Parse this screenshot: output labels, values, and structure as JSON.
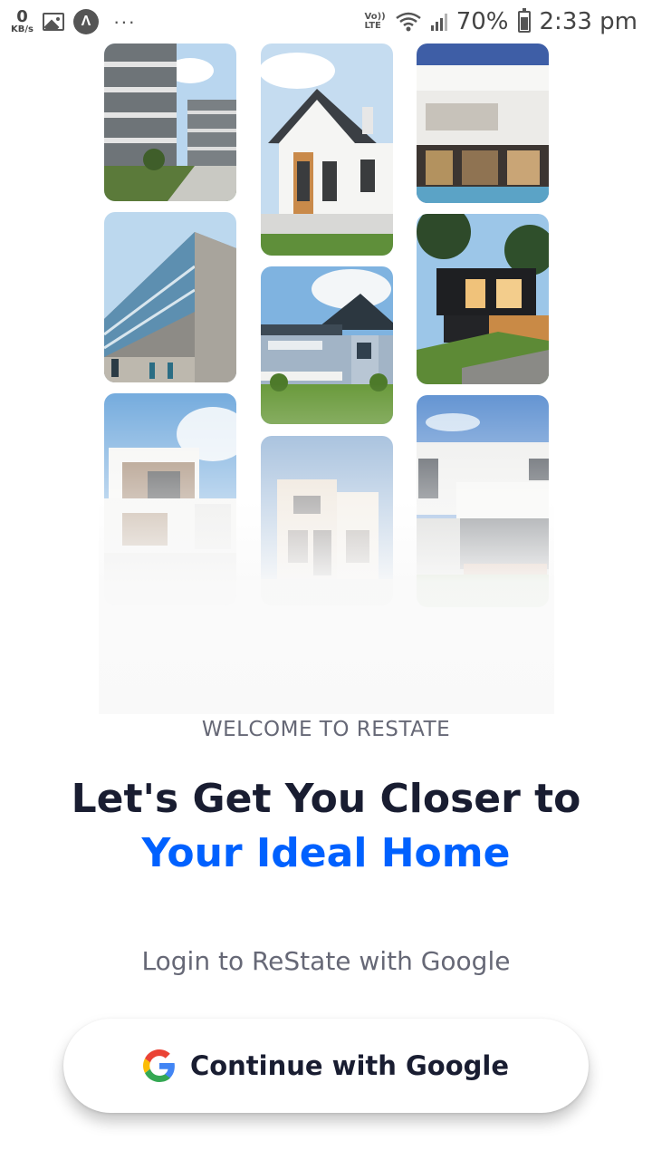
{
  "status_bar": {
    "net_speed_value": "0",
    "net_speed_unit": "KB/s",
    "more_label": "···",
    "volte_top": "Vo))",
    "volte_bottom": "LTE",
    "battery_percent": "70%",
    "battery_level": 0.7,
    "time": "2:33 pm",
    "icons": [
      "image-icon",
      "app-a-icon",
      "wifi-icon",
      "signal-icon",
      "battery-icon"
    ]
  },
  "collage": {
    "images": [
      {
        "name": "apartment-building",
        "column": 1
      },
      {
        "name": "glass-facade-building",
        "column": 1
      },
      {
        "name": "modern-white-villa",
        "column": 1
      },
      {
        "name": "gabled-house",
        "column": 2
      },
      {
        "name": "blue-siding-house",
        "column": 2
      },
      {
        "name": "beige-townhouse",
        "column": 2
      },
      {
        "name": "white-modern-pool-house",
        "column": 3
      },
      {
        "name": "black-modern-house",
        "column": 3
      },
      {
        "name": "white-cube-house",
        "column": 3
      }
    ]
  },
  "welcome": {
    "eyebrow": "WELCOME TO RESTATE",
    "headline_line1": "Let's Get You Closer to",
    "headline_line2": "Your Ideal Home",
    "subtitle": "Login to ReState with Google"
  },
  "google_button": {
    "label": "Continue with Google",
    "icon": "google-logo-icon"
  },
  "colors": {
    "accent": "#0061FF",
    "heading": "#191D31",
    "muted": "#666876"
  }
}
